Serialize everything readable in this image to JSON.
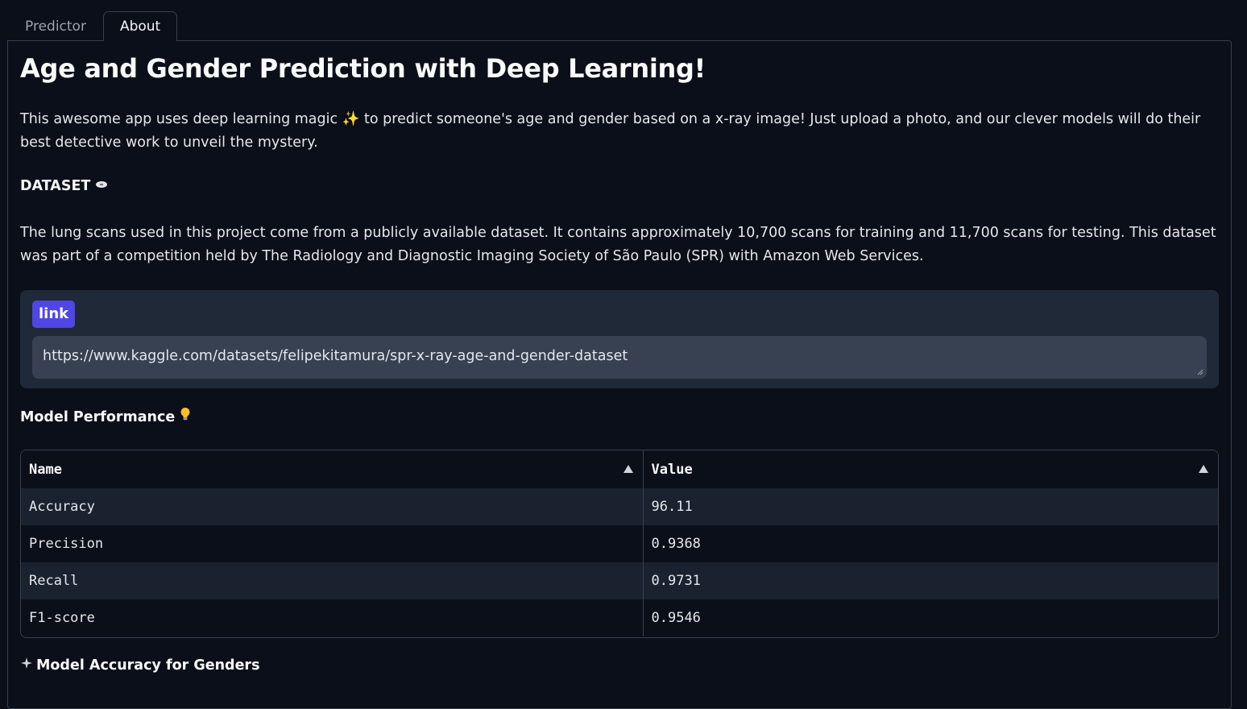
{
  "tabs": [
    {
      "label": "Predictor",
      "active": false
    },
    {
      "label": "About",
      "active": true
    }
  ],
  "about": {
    "title": "Age and Gender Prediction with Deep Learning!",
    "description": "This awesome app uses deep learning magic ✨ to predict someone's age and gender based on a x-ray image! Just upload a photo, and our clever models will do their best detective work to unveil the mystery.",
    "dataset_title": "DATASET",
    "dataset_description": "The lung scans used in this project come from a publicly available dataset. It contains approximately 10,700 scans for training and 11,700 scans for testing. This dataset was part of a competition held by The Radiology and Diagnostic Imaging Society of São Paulo (SPR) with Amazon Web Services.",
    "link_label": "link",
    "link_value": "https://www.kaggle.com/datasets/felipekitamura/spr-x-ray-age-and-gender-dataset",
    "performance_title": "Model Performance",
    "gender_title": "Model Accuracy for Genders"
  },
  "table": {
    "headers": [
      "Name",
      "Value"
    ],
    "rows": [
      [
        "Accuracy",
        "96.11"
      ],
      [
        "Precision",
        "0.9368"
      ],
      [
        "Recall",
        "0.9731"
      ],
      [
        "F1-score",
        "0.9546"
      ]
    ]
  },
  "icons": {
    "dataset": "disk-icon",
    "performance": "lightbulb-icon",
    "gender": "sparkle-icon"
  },
  "colors": {
    "background": "#0b0f19",
    "accent": "#4f46e5",
    "panel_block": "#1f2937"
  }
}
